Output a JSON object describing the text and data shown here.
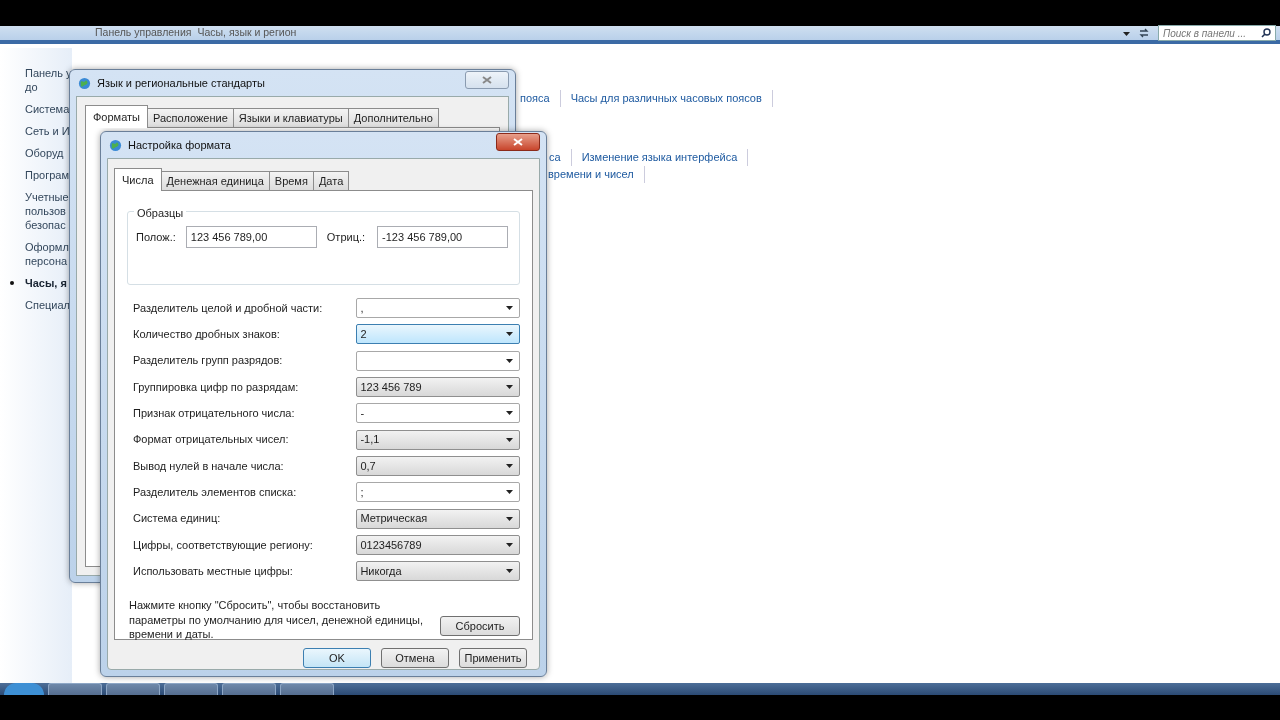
{
  "explorer": {
    "breadcrumb": [
      "Панель управления",
      "Часы, язык и регион"
    ],
    "search": {
      "placeholder": "Поиск в панели ..."
    },
    "sidebar": [
      {
        "lines": [
          "Панель у",
          "до"
        ],
        "selected": false
      },
      {
        "lines": [
          "Система"
        ],
        "selected": false
      },
      {
        "lines": [
          "Сеть и И"
        ],
        "selected": false
      },
      {
        "lines": [
          "Оборуд"
        ],
        "selected": false
      },
      {
        "lines": [
          "Програм"
        ],
        "selected": false
      },
      {
        "lines": [
          "Учетные",
          "пользов",
          "безопас"
        ],
        "selected": false
      },
      {
        "lines": [
          "Оформл",
          "персона"
        ],
        "selected": false
      },
      {
        "lines": [
          "Часы, я"
        ],
        "selected": true
      },
      {
        "lines": [
          "Специал"
        ],
        "selected": false
      }
    ],
    "link_rows": [
      [
        "пояса",
        "Часы для различных часовых поясов"
      ],
      [
        "са",
        "Изменение языка интерфейса"
      ],
      [
        "времени и чисел"
      ]
    ]
  },
  "region_dialog": {
    "title": "Язык и региональные стандарты",
    "tabs": [
      {
        "label": "Форматы",
        "selected": true
      },
      {
        "label": "Расположение",
        "selected": false
      },
      {
        "label": "Языки и клавиатуры",
        "selected": false
      },
      {
        "label": "Дополнительно",
        "selected": false
      }
    ]
  },
  "format_dialog": {
    "title": "Настройка формата",
    "tabs": [
      {
        "label": "Числа",
        "selected": true
      },
      {
        "label": "Денежная единица",
        "selected": false
      },
      {
        "label": "Время",
        "selected": false
      },
      {
        "label": "Дата",
        "selected": false
      }
    ],
    "samples": {
      "title": "Образцы",
      "positive_label": "Полож.:",
      "positive": "123 456 789,00",
      "negative_label": "Отриц.:",
      "negative": "-123 456 789,00"
    },
    "settings": [
      {
        "label": "Разделитель целой и дробной части:",
        "value": ",",
        "kind": "edit",
        "highlighted": false
      },
      {
        "label": "Количество дробных знаков:",
        "value": "2",
        "kind": "list",
        "highlighted": true
      },
      {
        "label": "Разделитель групп разрядов:",
        "kind": "edit",
        "highlighted": false
      },
      {
        "label": "Группировка цифр по разрядам:",
        "value": "123 456 789",
        "kind": "list",
        "highlighted": false
      },
      {
        "label": "Признак отрицательного числа:",
        "value": "-",
        "kind": "edit",
        "highlighted": false
      },
      {
        "label": "Формат отрицательных чисел:",
        "value": "-1,1",
        "kind": "list",
        "highlighted": false
      },
      {
        "label": "Вывод нулей в начале числа:",
        "value": "0,7",
        "kind": "list",
        "highlighted": false
      },
      {
        "label": "Разделитель элементов списка:",
        "value": ";",
        "kind": "edit",
        "highlighted": false
      },
      {
        "label": "Система единиц:",
        "value": "Метрическая",
        "kind": "list",
        "highlighted": false
      },
      {
        "label": "Цифры, соответствующие региону:",
        "value": "0123456789",
        "kind": "list",
        "highlighted": false
      },
      {
        "label": "Использовать местные цифры:",
        "value": "Никогда",
        "kind": "list",
        "highlighted": false
      }
    ],
    "note": "Нажмите кнопку \"Сбросить\", чтобы восстановить параметры по умолчанию для чисел, денежной единицы, времени и даты.",
    "reset_button": "Сбросить",
    "buttons": [
      {
        "label": "OK",
        "default": true
      },
      {
        "label": "Отмена",
        "default": false
      },
      {
        "label": "Применить",
        "default": false
      }
    ]
  }
}
